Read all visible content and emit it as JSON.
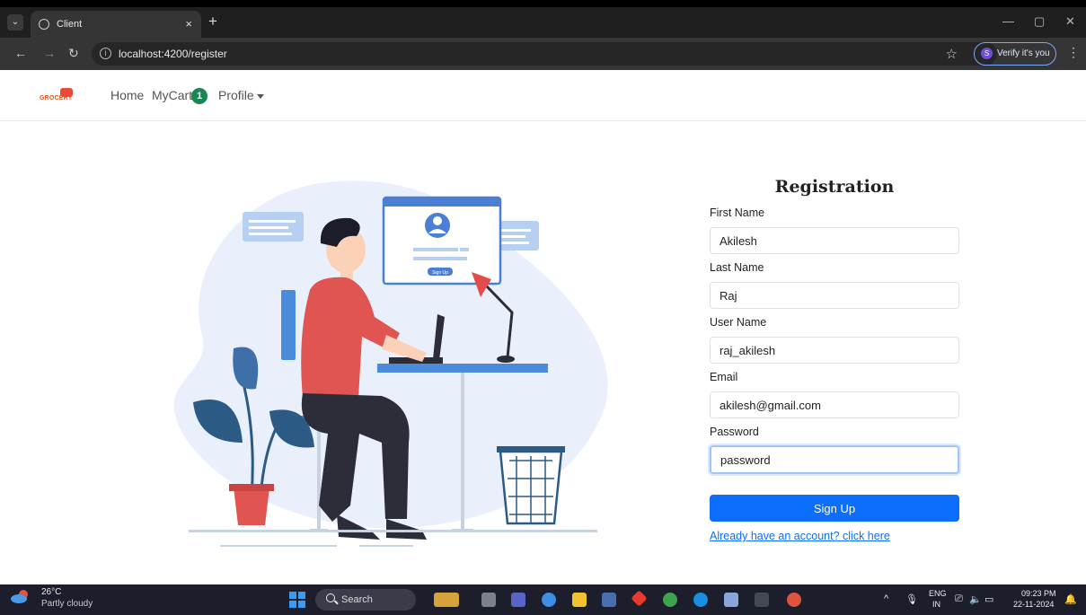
{
  "browser": {
    "tab_title": "Client",
    "tab_close": "×",
    "new_tab": "+",
    "url": "localhost:4200/register",
    "verify_label": "Verify it's you",
    "verify_icon_letter": "S"
  },
  "navbar": {
    "logo_text": "GROCERY",
    "home": "Home",
    "mycart": "MyCart",
    "cart_count": "1",
    "profile": "Profile"
  },
  "form": {
    "title": "Registration",
    "first_name_label": "First Name",
    "first_name_value": "Akilesh",
    "last_name_label": "Last Name",
    "last_name_value": "Raj",
    "user_name_label": "User Name",
    "user_name_value": "raj_akilesh",
    "email_label": "Email",
    "email_value": "akilesh@gmail.com",
    "password_label": "Password",
    "password_value": "password",
    "submit_label": "Sign Up",
    "login_link": "Already have an account? click here"
  },
  "illustration": {
    "screen_button_label": "Sign Up"
  },
  "taskbar": {
    "weather_temp": "26°C",
    "weather_desc": "Partly cloudy",
    "search_label": "Search",
    "language": "ENG",
    "region": "IN",
    "time": "09:23 PM",
    "date": "22-11-2024"
  },
  "colors": {
    "primary": "#0d6efd",
    "badge": "#198754",
    "chrome_dark": "#1f1f1f"
  }
}
